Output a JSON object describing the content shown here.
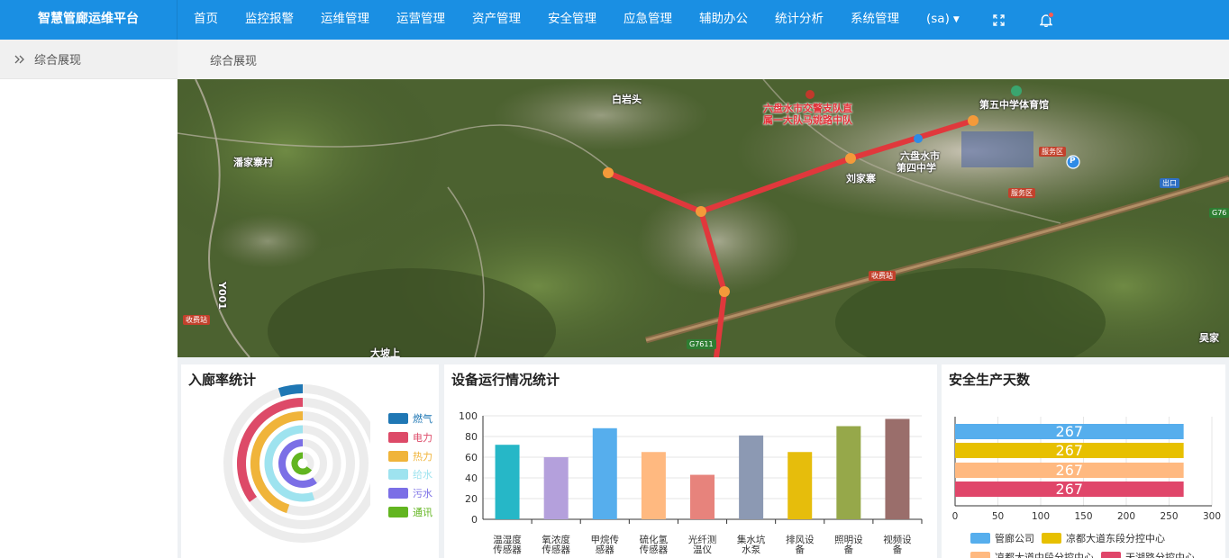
{
  "app": {
    "title": "智慧管廊运维平台"
  },
  "nav": {
    "items": [
      "首页",
      "监控报警",
      "运维管理",
      "运营管理",
      "资产管理",
      "安全管理",
      "应急管理",
      "辅助办公",
      "统计分析",
      "系统管理"
    ],
    "user": "(sa)"
  },
  "sidebar": {
    "header": "综合展现"
  },
  "breadcrumb": {
    "current": "综合展现"
  },
  "map": {
    "labels": {
      "baiyantou": "白岩头",
      "police": "六盘水市交警支队直",
      "police2": "属一大队马姚路中队",
      "stadium": "第五中学体育馆",
      "school1": "六盘水市",
      "school2": "第四中学",
      "village": "刘家寨",
      "left_village": "潘家寨村",
      "road_y001": "Y001",
      "bottom_village": "大坡上",
      "bottom_right": "吴家"
    },
    "badges": {
      "toll_left": "收费站",
      "toll_mid": "收费站",
      "service1": "服务区",
      "service2": "服务区",
      "exit": "出口",
      "g7611": "G7611",
      "g76": "G76"
    },
    "parking": "P"
  },
  "panels": {
    "entry_rate": {
      "title": "入廊率统计",
      "legend": [
        {
          "name": "燃气",
          "color": "#1f77b4"
        },
        {
          "name": "电力",
          "color": "#dd4a68"
        },
        {
          "name": "热力",
          "color": "#f0b43a"
        },
        {
          "name": "给水",
          "color": "#9ee3ef"
        },
        {
          "name": "污水",
          "color": "#7b6fe6"
        },
        {
          "name": "通讯",
          "color": "#62b520"
        }
      ]
    },
    "equipment": {
      "title": "设备运行情况统计"
    },
    "safety": {
      "title": "安全生产天数",
      "legend": [
        {
          "name": "管廊公司",
          "color": "#56aeed"
        },
        {
          "name": "凉都大道东段分控中心",
          "color": "#e7c000"
        },
        {
          "name": "凉都大道中段分控中心",
          "color": "#ffb980"
        },
        {
          "name": "天湖路分控中心",
          "color": "#e0466a"
        }
      ]
    }
  },
  "chart_data": [
    {
      "type": "pie",
      "title": "入廊率统计",
      "categories": [
        "燃气",
        "电力",
        "热力",
        "给水",
        "污水",
        "通讯"
      ],
      "values": [
        5,
        35,
        45,
        55,
        60,
        65
      ],
      "colors": [
        "#1f77b4",
        "#dd4a68",
        "#f0b43a",
        "#9ee3ef",
        "#7b6fe6",
        "#62b520"
      ]
    },
    {
      "type": "bar",
      "title": "设备运行情况统计",
      "categories": [
        "温湿度传感器",
        "氧浓度传感器",
        "甲烷传感器",
        "硫化氢传感器",
        "光纤测温仪",
        "集水坑水泵",
        "排风设备",
        "照明设备",
        "视频设备"
      ],
      "category_lines": [
        [
          "温湿度",
          "传感器"
        ],
        [
          "氧浓度",
          "传感器"
        ],
        [
          "甲烷传",
          "感器"
        ],
        [
          "硫化氢",
          "传感器"
        ],
        [
          "光纤测",
          "温仪"
        ],
        [
          "集水坑",
          "水泵"
        ],
        [
          "排风设",
          "备"
        ],
        [
          "照明设",
          "备"
        ],
        [
          "视频设",
          "备"
        ]
      ],
      "values": [
        72,
        60,
        88,
        65,
        43,
        81,
        65,
        90,
        97
      ],
      "colors": [
        "#26b7c7",
        "#b4a0dc",
        "#56aeed",
        "#ffb980",
        "#e7837c",
        "#8c99b3",
        "#e6bd0c",
        "#96a84a",
        "#9a6e6b"
      ],
      "yticks": [
        0,
        20,
        40,
        60,
        80,
        100
      ],
      "ylim": [
        0,
        100
      ]
    },
    {
      "type": "bar",
      "title": "安全生产天数",
      "orientation": "horizontal",
      "series": [
        {
          "name": "管廊公司",
          "values": [
            267
          ]
        },
        {
          "name": "凉都大道东段分控中心",
          "values": [
            267
          ]
        },
        {
          "name": "凉都大道中段分控中心",
          "values": [
            267
          ]
        },
        {
          "name": "天湖路分控中心",
          "values": [
            267
          ]
        }
      ],
      "colors": [
        "#56aeed",
        "#e7c000",
        "#ffb980",
        "#e0466a"
      ],
      "xticks": [
        0,
        50,
        100,
        150,
        200,
        250,
        300
      ],
      "xlim": [
        0,
        300
      ]
    }
  ]
}
